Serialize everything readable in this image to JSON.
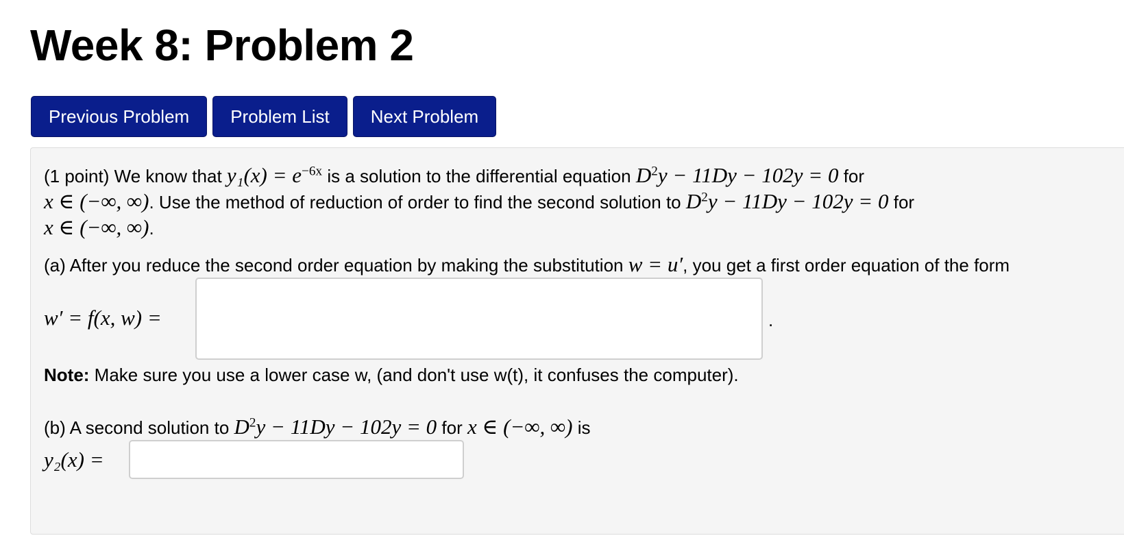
{
  "page": {
    "title": "Week 8: Problem 2"
  },
  "nav": {
    "previous_label": "Previous Problem",
    "list_label": "Problem List",
    "next_label": "Next Problem"
  },
  "problem": {
    "points": "(1 point)",
    "intro_1": "We know that",
    "y1_expr": "y₁(x) = e",
    "y1_exp": "−6x",
    "intro_2": "is a solution to the differential equation",
    "eq_D": "D",
    "eq_sq": "2",
    "eq_rest": "y − 11Dy − 102y = 0",
    "for_word": "for",
    "domain": "x ∈ (−∞, ∞)",
    "line2_text": ". Use the method of reduction of order to find the second solution to",
    "line3_end": "."
  },
  "part_a": {
    "text": "(a) After you reduce the second order equation by making the substitution",
    "sub_expr": "w = u′",
    "text_end": ", you get a first order equation of the form",
    "lhs": "w′ = f(x, w) =",
    "answer_value": "",
    "trailing": "."
  },
  "note": {
    "label": "Note:",
    "text": " Make sure you use a lower case w, (and don't use w(t), it confuses the computer)."
  },
  "part_b": {
    "text": "(b) A second solution to",
    "is_word": "is",
    "lhs": "y₂(x) =",
    "answer_value": ""
  }
}
